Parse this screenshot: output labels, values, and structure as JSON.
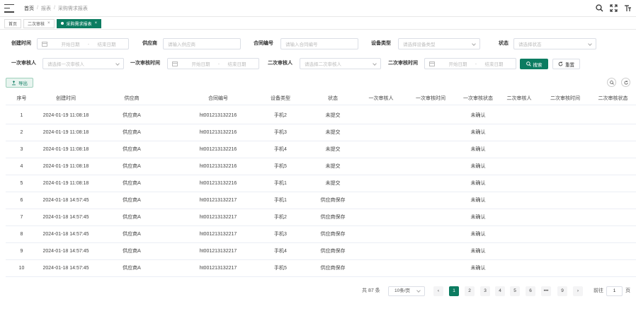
{
  "breadcrumb": [
    "首页",
    "报表",
    "采购需求报表"
  ],
  "tabs": [
    {
      "label": "首页",
      "closable": false,
      "active": false
    },
    {
      "label": "二次审核",
      "closable": true,
      "active": false
    },
    {
      "label": "采购需求报表",
      "closable": true,
      "active": true
    }
  ],
  "filters": {
    "created_label": "创建时间",
    "start_placeholder": "开始日期",
    "range_sep": "-",
    "end_placeholder": "结束日期",
    "supplier_label": "供应商",
    "supplier_placeholder": "请输入供应商",
    "contract_label": "合同编号",
    "contract_placeholder": "请输入合同编号",
    "device_label": "设备类型",
    "device_placeholder": "请选择设备类型",
    "status_label": "状态",
    "status_placeholder": "请选择状态",
    "rev1_label": "一次审核人",
    "rev1_placeholder": "请选择一次审核人",
    "rev1_time_label": "一次审核时间",
    "rev2_label": "二次审核人",
    "rev2_placeholder": "请选择二次审核人",
    "rev2_time_label": "二次审核时间"
  },
  "buttons": {
    "search": "搜索",
    "reset": "重置",
    "export": "导出"
  },
  "table": {
    "columns": [
      "序号",
      "创建时间",
      "供应商",
      "合同编号",
      "设备类型",
      "状态",
      "一次审核人",
      "一次审核时间",
      "一次审核状态",
      "二次审核人",
      "二次审核时间",
      "二次审核状态"
    ],
    "rows": [
      [
        "1",
        "2024-01-19 11:08:18",
        "供应商A",
        "ht001213132216",
        "手机2",
        "未提交",
        "",
        "",
        "未确认",
        "",
        "",
        ""
      ],
      [
        "2",
        "2024-01-19 11:08:18",
        "供应商A",
        "ht001213132216",
        "手机3",
        "未提交",
        "",
        "",
        "未确认",
        "",
        "",
        ""
      ],
      [
        "3",
        "2024-01-19 11:08:18",
        "供应商A",
        "ht001213132216",
        "手机4",
        "未提交",
        "",
        "",
        "未确认",
        "",
        "",
        ""
      ],
      [
        "4",
        "2024-01-19 11:08:18",
        "供应商A",
        "ht001213132216",
        "手机5",
        "未提交",
        "",
        "",
        "未确认",
        "",
        "",
        ""
      ],
      [
        "5",
        "2024-01-19 11:08:18",
        "供应商A",
        "ht001213132216",
        "手机1",
        "未提交",
        "",
        "",
        "未确认",
        "",
        "",
        ""
      ],
      [
        "6",
        "2024-01-18 14:57:45",
        "供应商A",
        "ht001213132217",
        "手机1",
        "供应商保存",
        "",
        "",
        "未确认",
        "",
        "",
        ""
      ],
      [
        "7",
        "2024-01-18 14:57:45",
        "供应商A",
        "ht001213132217",
        "手机2",
        "供应商保存",
        "",
        "",
        "未确认",
        "",
        "",
        ""
      ],
      [
        "8",
        "2024-01-18 14:57:45",
        "供应商A",
        "ht001213132217",
        "手机3",
        "供应商保存",
        "",
        "",
        "未确认",
        "",
        "",
        ""
      ],
      [
        "9",
        "2024-01-18 14:57:45",
        "供应商A",
        "ht001213132217",
        "手机4",
        "供应商保存",
        "",
        "",
        "未确认",
        "",
        "",
        ""
      ],
      [
        "10",
        "2024-01-18 14:57:45",
        "供应商A",
        "ht001213132217",
        "手机5",
        "供应商保存",
        "",
        "",
        "未确认",
        "",
        "",
        ""
      ]
    ]
  },
  "pagination": {
    "total": "共 87 条",
    "page_size": "10条/页",
    "pages": [
      "1",
      "2",
      "3",
      "4",
      "5",
      "6",
      "•••",
      "9"
    ],
    "current": "1",
    "goto_label": "前往",
    "goto_value": "1",
    "goto_unit": "页",
    "prev": "‹",
    "next": "›"
  },
  "icons": {
    "search": "search-icon",
    "fullscreen": "fullscreen-icon",
    "font_size": "font-size-icon"
  },
  "colors": {
    "primary": "#0c7c61"
  }
}
